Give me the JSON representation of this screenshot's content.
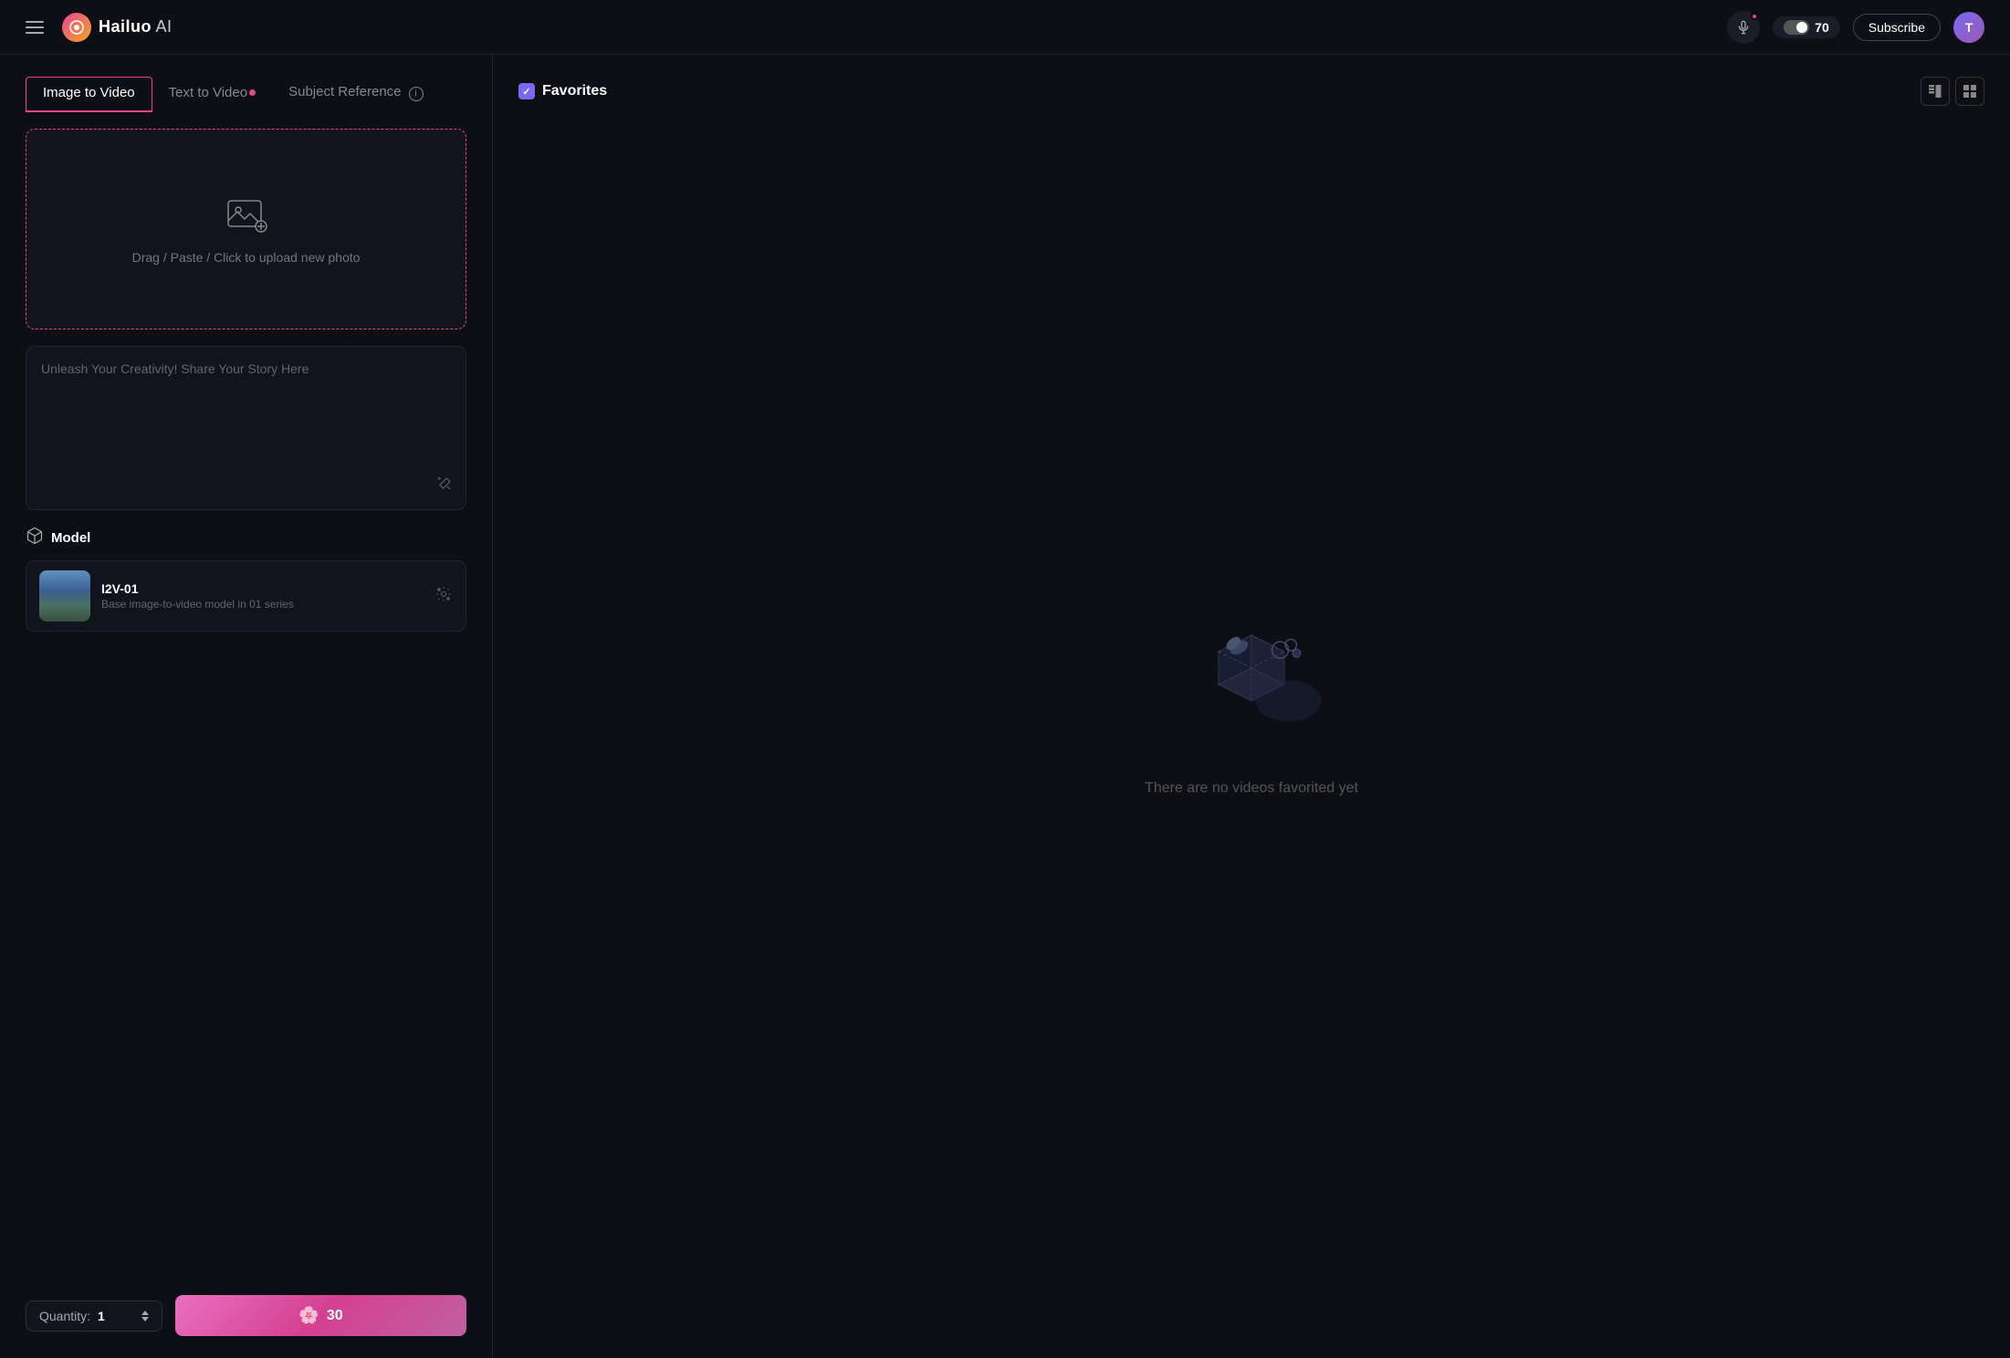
{
  "header": {
    "logo_text": "Hailuo",
    "logo_ai": " AI",
    "coins": "70",
    "subscribe_label": "Subscribe"
  },
  "tabs": [
    {
      "id": "image-to-video",
      "label": "Image to Video",
      "active": true,
      "dot": false
    },
    {
      "id": "text-to-video",
      "label": "Text to Video",
      "active": false,
      "dot": true
    },
    {
      "id": "subject-reference",
      "label": "Subject Reference",
      "active": false,
      "dot": false,
      "info": true
    }
  ],
  "upload": {
    "text": "Drag / Paste / Click to upload new photo"
  },
  "prompt": {
    "placeholder": "Unleash Your Creativity! Share Your Story Here"
  },
  "model_section": {
    "label": "Model",
    "model_name": "I2V-01",
    "model_desc": "Base image-to-video model in 01 series"
  },
  "controls": {
    "quantity_label": "Quantity:",
    "quantity_value": "1",
    "generate_cost": "30"
  },
  "favorites": {
    "title": "Favorites",
    "empty_text": "There are no videos favorited yet"
  },
  "icons": {
    "hamburger": "☰",
    "mic": "🎤",
    "wand": "✏️",
    "settings": "⚙️",
    "check": "✓",
    "grid_view": "▬",
    "list_view": "≡"
  }
}
